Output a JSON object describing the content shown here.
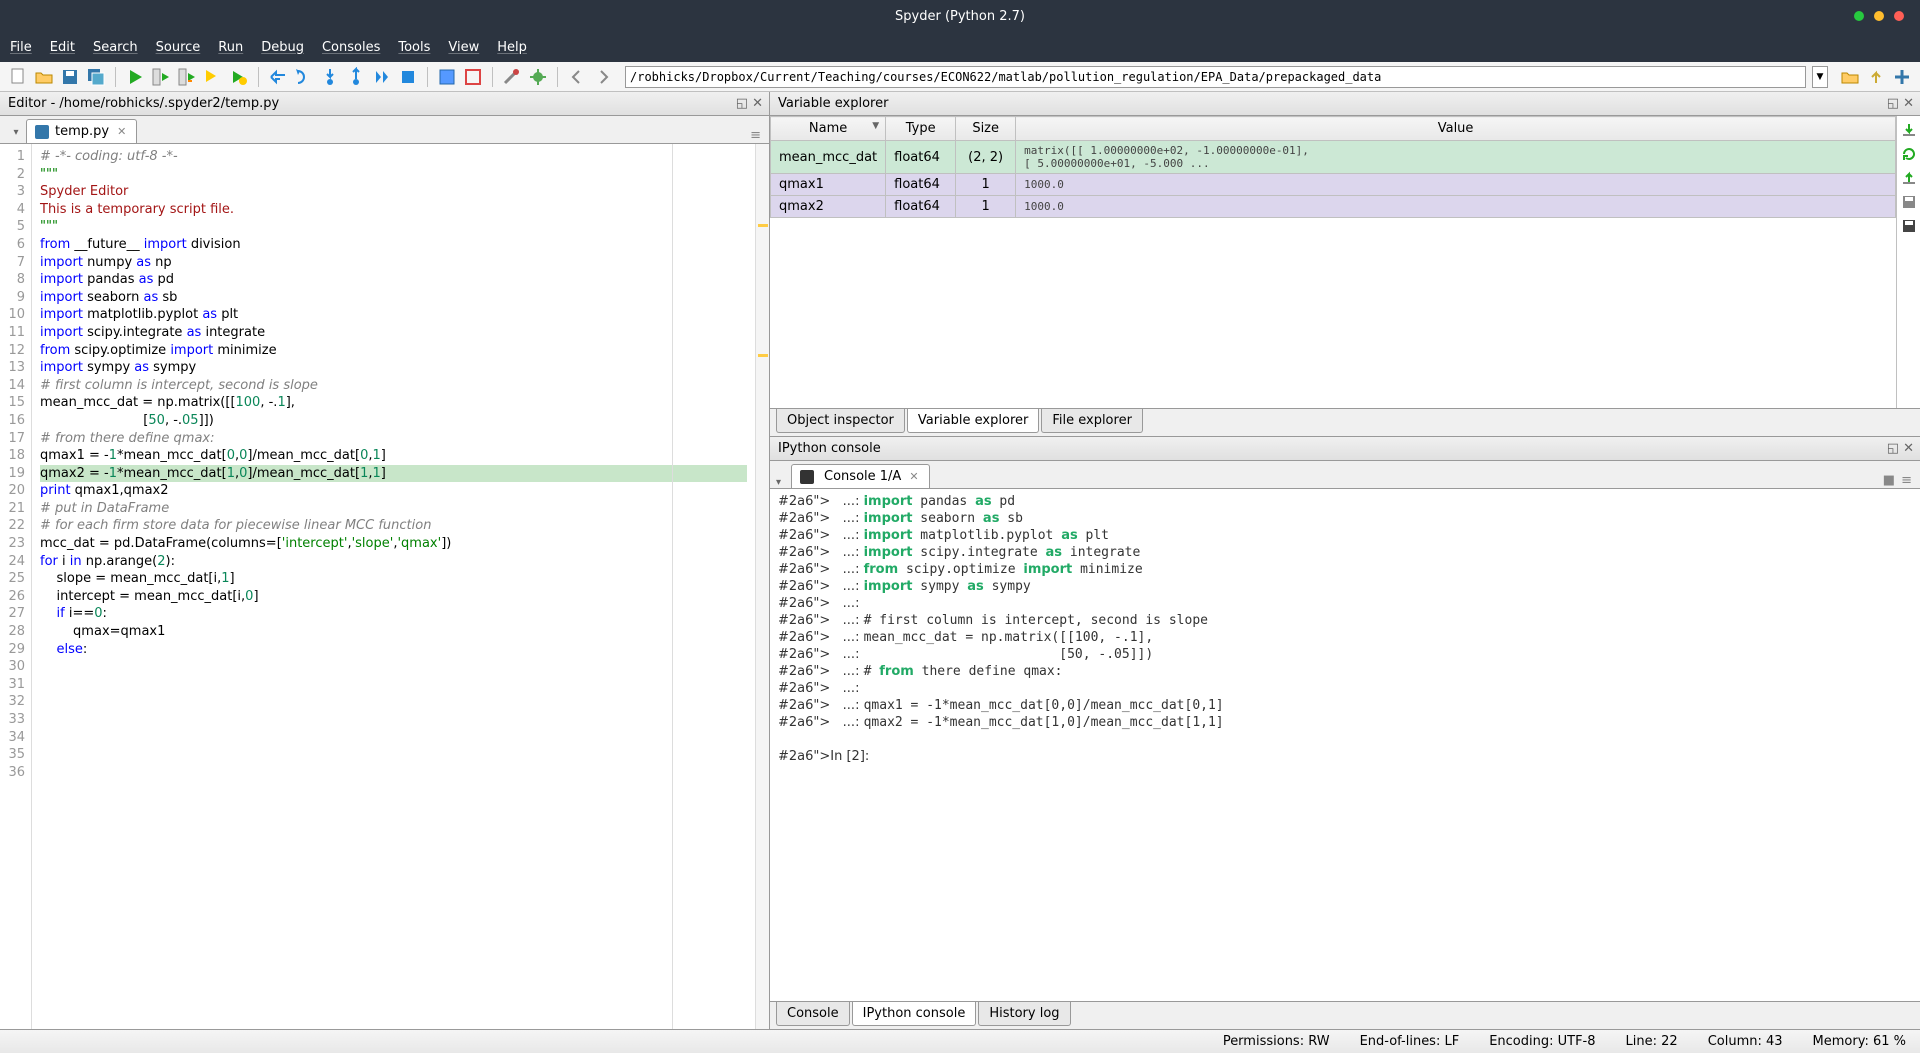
{
  "window": {
    "title": "Spyder (Python 2.7)"
  },
  "menubar": [
    "File",
    "Edit",
    "Search",
    "Source",
    "Run",
    "Debug",
    "Consoles",
    "Tools",
    "View",
    "Help"
  ],
  "path_value": "/robhicks/Dropbox/Current/Teaching/courses/ECON622/matlab/pollution_regulation/EPA_Data/prepackaged_data",
  "editor": {
    "header": "Editor - /home/robhicks/.spyder2/temp.py",
    "tab_label": "temp.py",
    "highlighted_line": 22
  },
  "code_lines": [
    {
      "n": 1,
      "t": "# -*- coding: utf-8 -*-",
      "cls": "c-com"
    },
    {
      "n": 2,
      "t": "\"\"\"",
      "cls": "c-doc"
    },
    {
      "n": 3,
      "t": "Spyder Editor",
      "cls": "c-sy"
    },
    {
      "n": 4,
      "t": ""
    },
    {
      "n": 5,
      "t": "This is a temporary script file.",
      "cls": "c-sy"
    },
    {
      "n": 6,
      "t": "\"\"\"",
      "cls": "c-doc"
    },
    {
      "n": 7,
      "t": "from __future__ import division",
      "cls": "kw"
    },
    {
      "n": 8,
      "t": "import numpy as np",
      "cls": "kw"
    },
    {
      "n": 9,
      "t": "import pandas as pd",
      "cls": "kw"
    },
    {
      "n": 10,
      "t": "import seaborn as sb",
      "cls": "kw",
      "warn": true
    },
    {
      "n": 11,
      "t": "import matplotlib.pyplot as plt",
      "cls": "kw",
      "warn": true
    },
    {
      "n": 12,
      "t": "import scipy.integrate as integrate",
      "cls": "kw"
    },
    {
      "n": 13,
      "t": "from scipy.optimize import minimize",
      "cls": "kw"
    },
    {
      "n": 14,
      "t": "import sympy as sympy",
      "cls": "kw",
      "warn": true
    },
    {
      "n": 15,
      "t": ""
    },
    {
      "n": 16,
      "t": "# first column is intercept, second is slope",
      "cls": "c-com"
    },
    {
      "n": 17,
      "t": "mean_mcc_dat = np.matrix([[100, -.1],"
    },
    {
      "n": 18,
      "t": "                         [50, -.05]])"
    },
    {
      "n": 19,
      "t": "# from there define qmax:",
      "cls": "c-com"
    },
    {
      "n": 20,
      "t": ""
    },
    {
      "n": 21,
      "t": "qmax1 = -1*mean_mcc_dat[0,0]/mean_mcc_dat[0,1]"
    },
    {
      "n": 22,
      "t": "qmax2 = -1*mean_mcc_dat[1,0]/mean_mcc_dat[1,1]",
      "hl": true
    },
    {
      "n": 23,
      "t": ""
    },
    {
      "n": 24,
      "t": "print qmax1,qmax2",
      "cls": "kw"
    },
    {
      "n": 25,
      "t": ""
    },
    {
      "n": 26,
      "t": "# put in DataFrame",
      "cls": "c-com"
    },
    {
      "n": 27,
      "t": "# for each firm store data for piecewise linear MCC function",
      "cls": "c-com"
    },
    {
      "n": 28,
      "t": "mcc_dat = pd.DataFrame(columns=['intercept','slope','qmax'])"
    },
    {
      "n": 29,
      "t": ""
    },
    {
      "n": 30,
      "t": "for i in np.arange(2):",
      "cls": "kw"
    },
    {
      "n": 31,
      "t": "    slope = mean_mcc_dat[i,1]"
    },
    {
      "n": 32,
      "t": "    intercept = mean_mcc_dat[i,0]"
    },
    {
      "n": 33,
      "t": ""
    },
    {
      "n": 34,
      "t": "    if i==0:",
      "cls": "kw"
    },
    {
      "n": 35,
      "t": "        qmax=qmax1"
    },
    {
      "n": 36,
      "t": "    else:",
      "cls": "kw"
    }
  ],
  "varex": {
    "header": "Variable explorer",
    "cols": [
      "Name",
      "Type",
      "Size",
      "Value"
    ],
    "rows": [
      {
        "name": "mean_mcc_dat",
        "type": "float64",
        "size": "(2, 2)",
        "value": "matrix([[  1.00000000e+02,  -1.00000000e-01],\n        [  5.00000000e+01,  -5.000 ...",
        "cls": "row-mat"
      },
      {
        "name": "qmax1",
        "type": "float64",
        "size": "1",
        "value": "1000.0",
        "cls": "row-flt"
      },
      {
        "name": "qmax2",
        "type": "float64",
        "size": "1",
        "value": "1000.0",
        "cls": "row-flt"
      }
    ],
    "tabs": [
      "Object inspector",
      "Variable explorer",
      "File explorer"
    ]
  },
  "ipython": {
    "header": "IPython console",
    "tab_label": "Console 1/A",
    "lines": [
      "   ...: import pandas as pd",
      "   ...: import seaborn as sb",
      "   ...: import matplotlib.pyplot as plt",
      "   ...: import scipy.integrate as integrate",
      "   ...: from scipy.optimize import minimize",
      "   ...: import sympy as sympy",
      "   ...: ",
      "   ...: # first column is intercept, second is slope",
      "   ...: mean_mcc_dat = np.matrix([[100, -.1],",
      "   ...:                          [50, -.05]])",
      "   ...: # from there define qmax:",
      "   ...: ",
      "   ...: qmax1 = -1*mean_mcc_dat[0,0]/mean_mcc_dat[0,1]",
      "   ...: qmax2 = -1*mean_mcc_dat[1,0]/mean_mcc_dat[1,1]",
      "",
      "In [2]: "
    ],
    "tabs": [
      "Console",
      "IPython console",
      "History log"
    ]
  },
  "statusbar": {
    "perm": "Permissions: RW",
    "eol": "End-of-lines: LF",
    "enc": "Encoding: UTF-8",
    "line": "Line: 22",
    "col": "Column: 43",
    "mem": "Memory: 61 %"
  }
}
